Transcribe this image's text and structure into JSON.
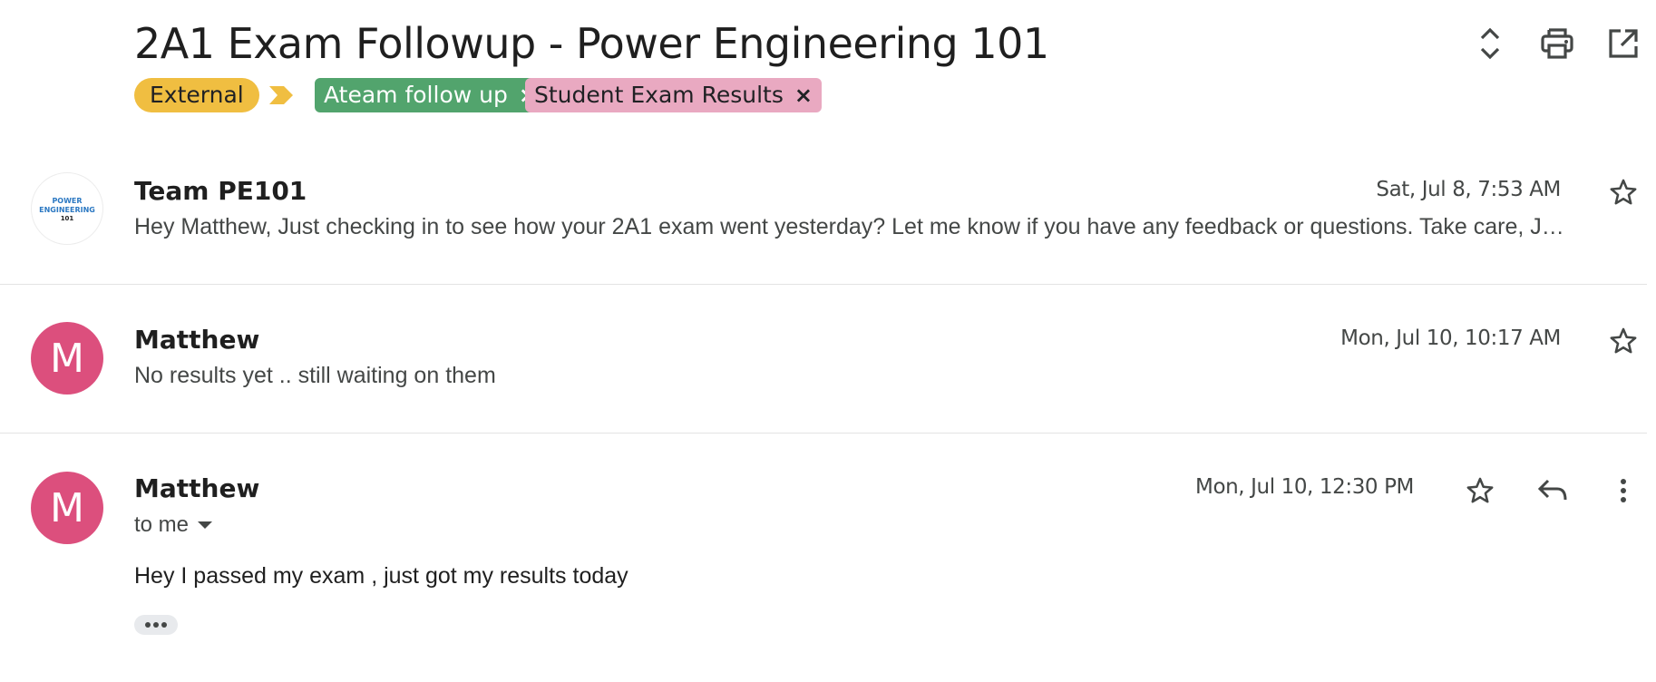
{
  "thread": {
    "subject": "2A1 Exam Followup - Power Engineering 101",
    "labels": {
      "external": "External",
      "ateam": "Ateam follow up",
      "results": "Student Exam Results",
      "remove": "×"
    },
    "actions": {
      "expand_icon": "unfold-icon",
      "print_icon": "print-icon",
      "popout_icon": "open-in-new-icon"
    }
  },
  "messages": [
    {
      "sender": "Team PE101",
      "avatar_logo": {
        "line1": "POWER",
        "line2": "ENGINEERING",
        "line3": "101"
      },
      "date": "Sat, Jul 8, 7:53 AM",
      "snippet": "Hey Matthew, Just checking in to see how your 2A1 exam went yesterday? Let me know if you have any feedback or questions. Take care, J…"
    },
    {
      "sender": "Matthew",
      "avatar_letter": "M",
      "date": "Mon, Jul 10, 10:17 AM",
      "snippet": "No results yet .. still waiting on them"
    },
    {
      "sender": "Matthew",
      "avatar_letter": "M",
      "date": "Mon, Jul 10, 12:30 PM",
      "recipient": "to me",
      "body": "Hey I passed my exam , just got my results today"
    }
  ],
  "colors": {
    "avatar": "#dc4f7d",
    "external_label": "#f0be41",
    "ateam_label": "#52a46d",
    "results_label": "#e9a9c1"
  }
}
